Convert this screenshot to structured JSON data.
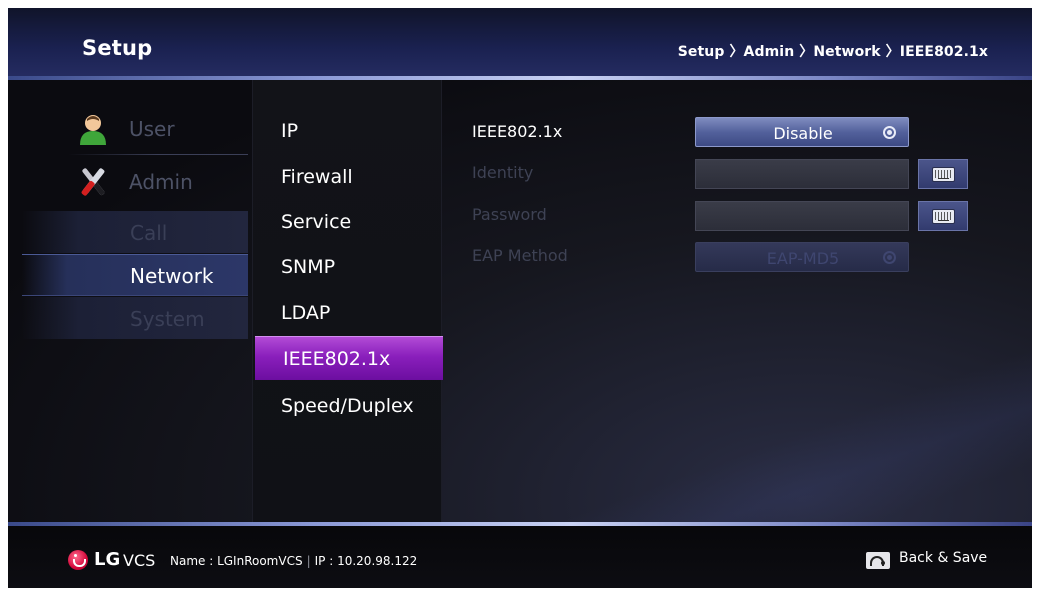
{
  "header": {
    "title": "Setup",
    "breadcrumb": "Setup 〉Admin 〉Network 〉IEEE802.1x"
  },
  "categories": {
    "user": {
      "label": "User",
      "icon": "user-icon"
    },
    "admin": {
      "label": "Admin",
      "icon": "tools-icon"
    },
    "admin_subitems": [
      {
        "label": "Call",
        "selected": false
      },
      {
        "label": "Network",
        "selected": true
      },
      {
        "label": "System",
        "selected": false
      }
    ]
  },
  "menu": {
    "items": [
      {
        "label": "IP",
        "selected": false
      },
      {
        "label": "Firewall",
        "selected": false
      },
      {
        "label": "Service",
        "selected": false
      },
      {
        "label": "SNMP",
        "selected": false
      },
      {
        "label": "LDAP",
        "selected": false
      },
      {
        "label": "IEEE802.1x",
        "selected": true
      },
      {
        "label": "Speed/Duplex",
        "selected": false
      }
    ]
  },
  "settings": {
    "ieee8021x": {
      "label": "IEEE802.1x",
      "value": "Disable",
      "enabled": true
    },
    "identity": {
      "label": "Identity",
      "value": "",
      "enabled": false
    },
    "password": {
      "label": "Password",
      "value": "",
      "enabled": false
    },
    "eap_method": {
      "label": "EAP Method",
      "value": "EAP-MD5",
      "enabled": false
    }
  },
  "footer": {
    "brand": "LG",
    "product": "VCS",
    "name_label": "Name : LGInRoomVCS",
    "ip_label": "IP : 10.20.98.122",
    "back_save_label": "Back & Save"
  },
  "colors": {
    "accent_selected": "#8a1fbc",
    "header_bg": "#1a2150",
    "brand_red": "#d4083a"
  }
}
